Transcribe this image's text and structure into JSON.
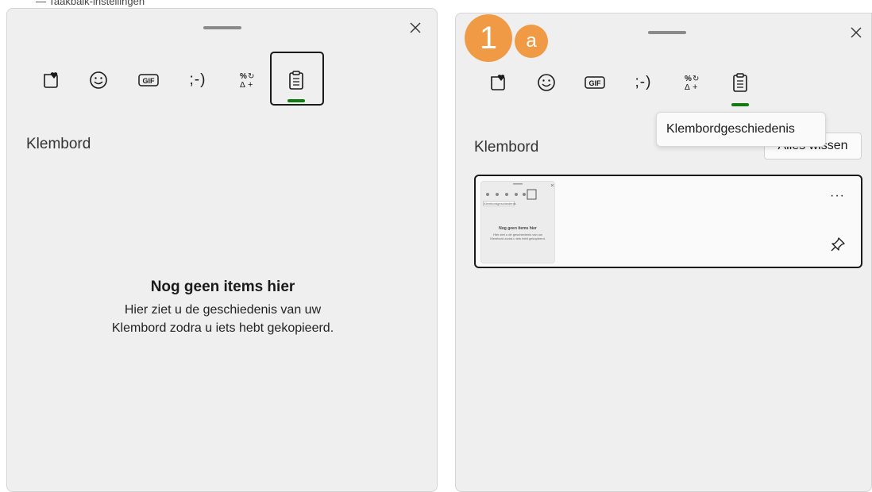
{
  "top_clipped_text": "— Taakbalk-instellingen",
  "left_panel": {
    "section_title": "Klembord",
    "empty_title": "Nog geen items hier",
    "empty_desc_line1": "Hier ziet u de geschiedenis van uw",
    "empty_desc_line2": "Klembord zodra u iets hebt gekopieerd.",
    "close_symbol": "✕",
    "tabs": [
      {
        "icon": "emoji-heart-icon"
      },
      {
        "icon": "smiley-icon"
      },
      {
        "icon": "gif-icon",
        "label": "GIF"
      },
      {
        "icon": "kaomoji-icon",
        "label": ";-)"
      },
      {
        "icon": "symbols-icon"
      },
      {
        "icon": "clipboard-icon",
        "active": true
      }
    ]
  },
  "right_panel": {
    "section_title": "Klembord",
    "clear_button": "Alles wissen",
    "tooltip": "Klembordgeschiedenis",
    "close_symbol": "✕",
    "badge_number": "1",
    "badge_letter": "a",
    "card_more": "···",
    "thumbnail": {
      "title": "Nog geen items hier",
      "line1": "Hier ziet u de geschiedenis van uw",
      "line2": "Klembord zodra u iets hebt gekopieerd.",
      "tooltip": "Klembordgeschiedenis"
    }
  },
  "colors": {
    "panel_bg": "#efefef",
    "accent_green": "#107c10",
    "badge_orange": "#f09a45"
  }
}
